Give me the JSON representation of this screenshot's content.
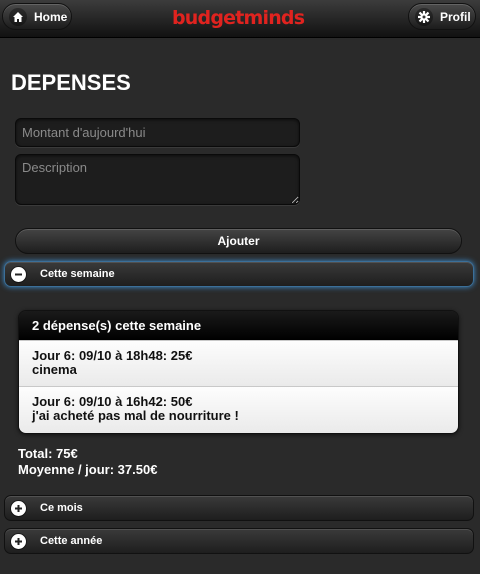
{
  "header": {
    "home_label": "Home",
    "brand": "budgetminds",
    "profile_label": "Profil",
    "brand_color": "#e0231f"
  },
  "page": {
    "title": "DEPENSES"
  },
  "form": {
    "amount_placeholder": "Montant d'aujourd'hui",
    "amount_value": "",
    "description_placeholder": "Description",
    "description_value": "",
    "submit_label": "Ajouter"
  },
  "sections": {
    "week": {
      "label": "Cette semaine",
      "state": "expanded",
      "icon": "minus-icon"
    },
    "month": {
      "label": "Ce mois",
      "state": "collapsed",
      "icon": "plus-icon"
    },
    "year": {
      "label": "Cette année",
      "state": "collapsed",
      "icon": "plus-icon"
    }
  },
  "week_list": {
    "header": "2 dépense(s) cette semaine",
    "items": [
      {
        "line1": "Jour 6: 09/10 à 18h48: 25€",
        "line2": "cinema"
      },
      {
        "line1": "Jour 6: 09/10 à 16h42: 50€",
        "line2": "j'ai acheté pas mal de nourriture !"
      }
    ],
    "total": "Total: 75€",
    "average": "Moyenne / jour: 37.50€"
  },
  "colors": {
    "focus_glow": "#3d8ed0",
    "background": "#2a2a2a"
  }
}
